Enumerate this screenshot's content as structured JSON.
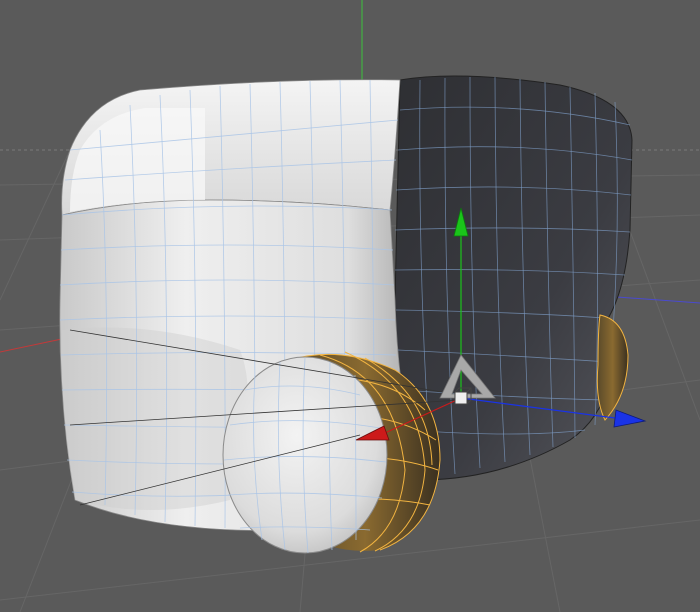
{
  "viewport": {
    "background_color": "#5a5a5a",
    "grid_color": "#6b6b6b",
    "horizon_color": "#8a8a8a"
  },
  "axes": {
    "world_x_color": "#c23a3a",
    "world_y_color": "#3cc13c",
    "world_z_color": "#3a3ac2"
  },
  "model": {
    "surface_light": "#e6e6e6",
    "surface_shadow": "#3a3b40",
    "wireframe_color": "#a9c4e6",
    "selected_edge_color": "#f2b441"
  },
  "gizmo": {
    "x_handle": "red-cone-icon",
    "y_handle": "green-cone-icon",
    "z_handle": "blue-cone-icon",
    "pivot": "pivot-cube-icon",
    "plane_handle": "triangle-plane-icon",
    "x_color": "#cc1a1a",
    "y_color": "#1ac41a",
    "z_color": "#1a33e6"
  }
}
